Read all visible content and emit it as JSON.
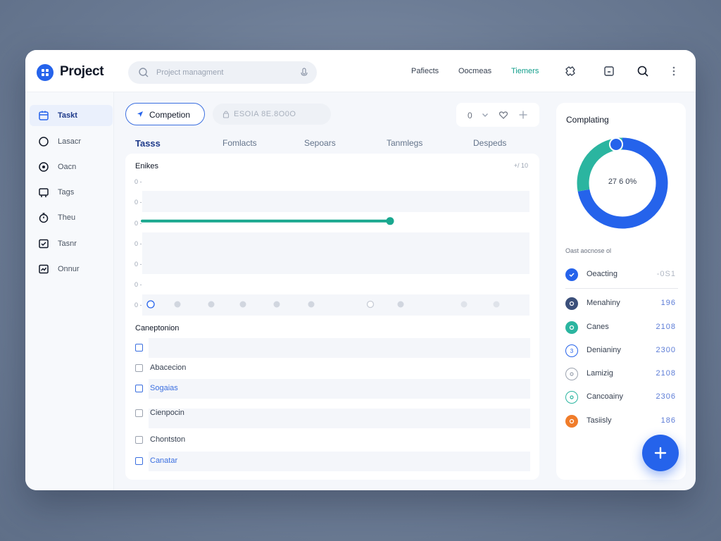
{
  "app": {
    "title": "Project"
  },
  "search": {
    "placeholder": "Project managment"
  },
  "header": {
    "nav": [
      {
        "label": "Pafiects",
        "active": false
      },
      {
        "label": "Oocmeas",
        "active": false
      },
      {
        "label": "Tiemers",
        "active": true
      }
    ],
    "icons": [
      "puzzle-icon",
      "square-minus-icon",
      "search-icon",
      "more-vertical-icon"
    ]
  },
  "sidebar": {
    "items": [
      {
        "label": "Taskt",
        "icon": "calendar-icon",
        "active": true
      },
      {
        "label": "Lasacr",
        "icon": "circle-icon",
        "active": false
      },
      {
        "label": "Oacn",
        "icon": "target-icon",
        "active": false
      },
      {
        "label": "Tags",
        "icon": "tag-icon",
        "active": false
      },
      {
        "label": "Theu",
        "icon": "clock-icon",
        "active": false
      },
      {
        "label": "Tasnr",
        "icon": "inbox-icon",
        "active": false
      },
      {
        "label": "Onnur",
        "icon": "chart-icon",
        "active": false
      }
    ]
  },
  "toolbar": {
    "primary_label": "Competion",
    "filter_text": "ESOIA 8E.8O0O",
    "count": "0"
  },
  "tabs": [
    "Tasss",
    "Fomlacts",
    "Sepoars",
    "Tanmlegs",
    "Despeds"
  ],
  "tasks_card": {
    "title": "Enikes",
    "meta": "+/ 10",
    "y_ticks": [
      "0 -",
      "0 -",
      "0 -",
      "0 -",
      "0 -",
      "0 -",
      "0 -"
    ],
    "section_title": "Caneptonion",
    "checklist": [
      {
        "label": "",
        "blue": true
      },
      {
        "label": "Abacecion",
        "blue": false
      },
      {
        "label": "Sogaias",
        "blue": true
      },
      {
        "label": "Cienpocin",
        "blue": false
      },
      {
        "label": "Chontston",
        "blue": false
      },
      {
        "label": "Canatar",
        "blue": true
      }
    ]
  },
  "right_panel": {
    "title": "Complating",
    "donut_label": "27 6 0%",
    "subtitle": "Oast   aocnose   ol",
    "legend": [
      {
        "label": "Oeacting",
        "value": "-0S1",
        "color": "#2563eb",
        "style": "solid"
      },
      {
        "label": "Menahiny",
        "value": "196",
        "color": "#3b4f7a",
        "style": "solid"
      },
      {
        "label": "Canes",
        "value": "2108",
        "color": "#2bb5a0",
        "style": "solid"
      },
      {
        "label": "Denianiny",
        "value": "2300",
        "color": "#2563eb",
        "style": "ring"
      },
      {
        "label": "Lamizig",
        "value": "2108",
        "color": "#9ca3af",
        "style": "ring"
      },
      {
        "label": "Cancoainy",
        "value": "2306",
        "color": "#2bb5a0",
        "style": "ring"
      },
      {
        "label": "Tasiisly",
        "value": "186",
        "color": "#f07c2a",
        "style": "solid"
      }
    ]
  },
  "chart_data": {
    "type": "line",
    "title": "",
    "series": [
      {
        "values": [
          0.7,
          0.7
        ]
      }
    ],
    "points": [
      1,
      2,
      3,
      4,
      5,
      6,
      7,
      8,
      9,
      10,
      11
    ],
    "donut": {
      "values": [
        72,
        28
      ],
      "colors": [
        "#2563eb",
        "#2bb5a0"
      ]
    }
  }
}
